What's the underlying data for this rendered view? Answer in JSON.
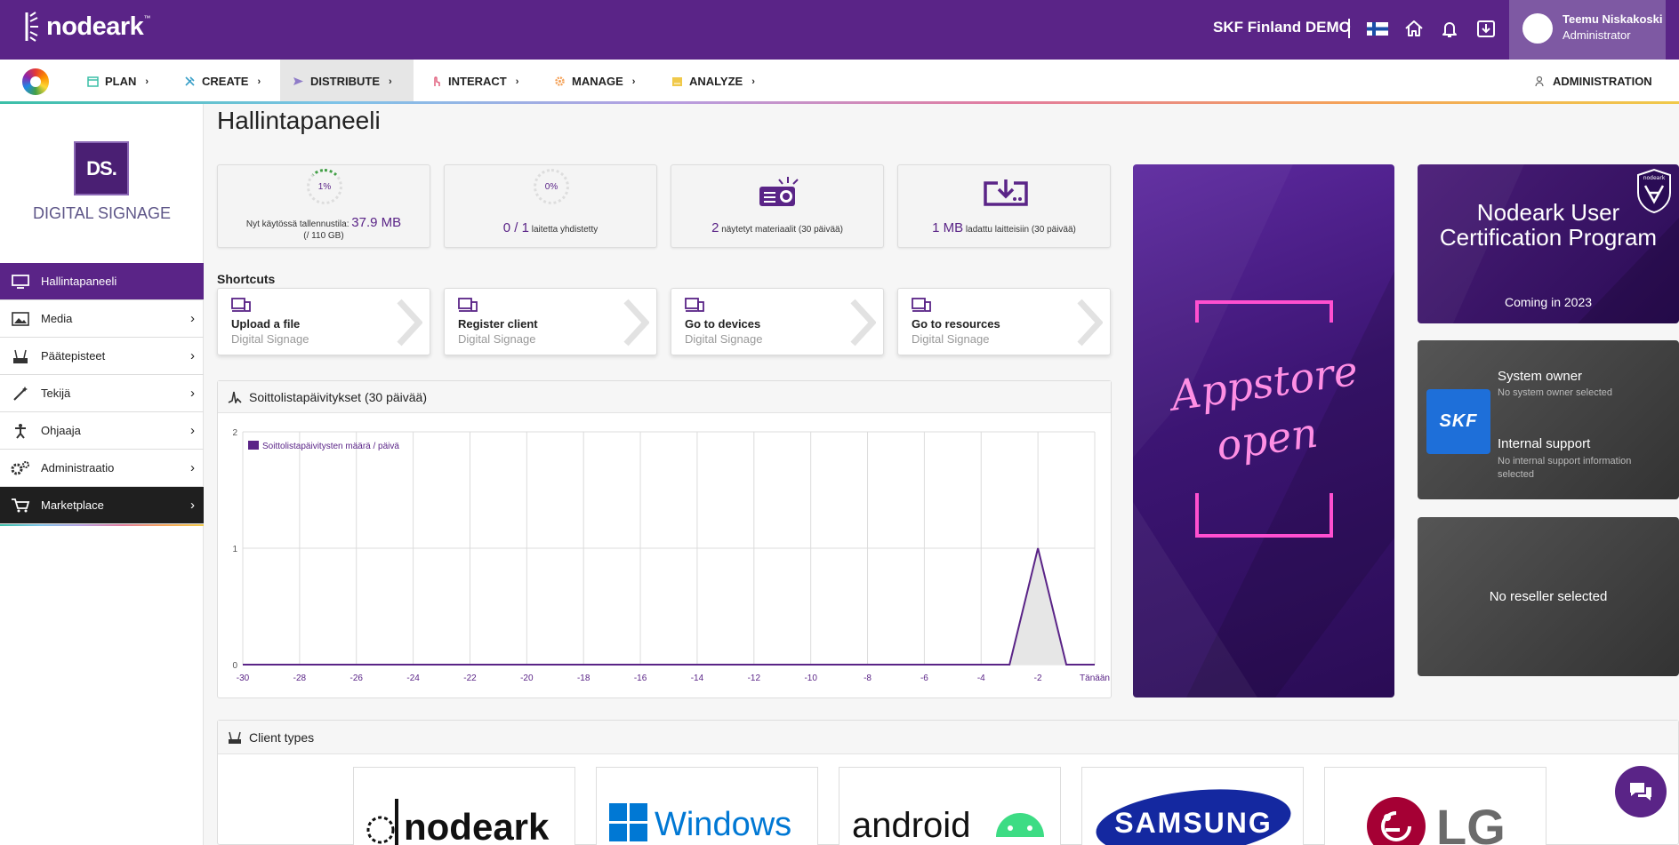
{
  "header": {
    "logo": "nodeark",
    "logo_tm": "™",
    "org": "SKF Finland DEMO",
    "user": {
      "name": "Teemu Niskakoski",
      "role": "Administrator"
    }
  },
  "nav": {
    "items": [
      {
        "label": "PLAN",
        "icon": "calendar-icon"
      },
      {
        "label": "CREATE",
        "icon": "tools-icon"
      },
      {
        "label": "DISTRIBUTE",
        "icon": "send-icon"
      },
      {
        "label": "INTERACT",
        "icon": "touch-icon"
      },
      {
        "label": "MANAGE",
        "icon": "gear-icon"
      },
      {
        "label": "ANALYZE",
        "icon": "chart-icon"
      }
    ],
    "active": "DISTRIBUTE",
    "admin": "ADMINISTRATION"
  },
  "sidebar": {
    "badge": "DS.",
    "title": "DIGITAL SIGNAGE",
    "items": [
      {
        "label": "Hallintapaneeli",
        "icon": "monitor-icon"
      },
      {
        "label": "Media",
        "icon": "image-icon"
      },
      {
        "label": "Päätepisteet",
        "icon": "router-icon"
      },
      {
        "label": "Tekijä",
        "icon": "magic-wand-icon"
      },
      {
        "label": "Ohjaaja",
        "icon": "director-icon"
      },
      {
        "label": "Administraatio",
        "icon": "gears-icon"
      },
      {
        "label": "Marketplace",
        "icon": "cart-icon"
      }
    ]
  },
  "page": {
    "title": "Hallintapaneeli"
  },
  "stats": [
    {
      "ring": "1%",
      "text_a": "Nyt käytössä tallennustila:",
      "big": "37.9 MB",
      "text_b": "(/ 110 GB)"
    },
    {
      "ring": "0%",
      "big": "0",
      "mid": " / ",
      "big2": "1",
      "text_a": "laitetta yhdistetty"
    },
    {
      "big": "2",
      "text_a": "näytetyt materiaalit (30 päivää)"
    },
    {
      "big": "1 MB",
      "text_a": "ladattu laitteisiin (30 päivää)"
    }
  ],
  "shortcuts": {
    "heading": "Shortcuts",
    "items": [
      {
        "title": "Upload a file",
        "sub": "Digital Signage"
      },
      {
        "title": "Register client",
        "sub": "Digital Signage"
      },
      {
        "title": "Go to devices",
        "sub": "Digital Signage"
      },
      {
        "title": "Go to resources",
        "sub": "Digital Signage"
      }
    ]
  },
  "chart_panel": {
    "title": "Soittolistapäivitykset (30 päivää)"
  },
  "chart_data": {
    "type": "area",
    "legend": "Soittolistapäivitysten määrä / päivä",
    "legend_position": "top-left",
    "grid": true,
    "x": [
      -30,
      -29,
      -28,
      -27,
      -26,
      -25,
      -24,
      -23,
      -22,
      -21,
      -20,
      -19,
      -18,
      -17,
      -16,
      -15,
      -14,
      -13,
      -12,
      -11,
      -10,
      -9,
      -8,
      -7,
      -6,
      -5,
      -4,
      -3,
      -2,
      -1,
      0
    ],
    "y": [
      0,
      0,
      0,
      0,
      0,
      0,
      0,
      0,
      0,
      0,
      0,
      0,
      0,
      0,
      0,
      0,
      0,
      0,
      0,
      0,
      0,
      0,
      0,
      0,
      0,
      0,
      0,
      0,
      1,
      0,
      0
    ],
    "x_ticks": [
      "-30",
      "-28",
      "-26",
      "-24",
      "-22",
      "-20",
      "-18",
      "-16",
      "-14",
      "-12",
      "-10",
      "-8",
      "-6",
      "-4",
      "-2",
      "Tänään"
    ],
    "y_ticks": [
      "0",
      "1",
      "2"
    ],
    "ylim": [
      0,
      2
    ],
    "color": "#5a2487"
  },
  "promo": {
    "appstore_line1": "Appstore",
    "appstore_line2": "open",
    "cert_title": "Nodeark User Certification Program",
    "cert_sub": "Coming in 2023",
    "cert_badge": "nodeark"
  },
  "owner_card": {
    "logo": "SKF",
    "owner_label": "System owner",
    "owner_value": "No system owner selected",
    "support_label": "Internal support",
    "support_value": "No internal support information selected"
  },
  "reseller": "No reseller selected",
  "client_types": {
    "title": "Client types",
    "logos": [
      "nodeark",
      "Windows",
      "android",
      "SAMSUNG",
      "LG"
    ]
  }
}
